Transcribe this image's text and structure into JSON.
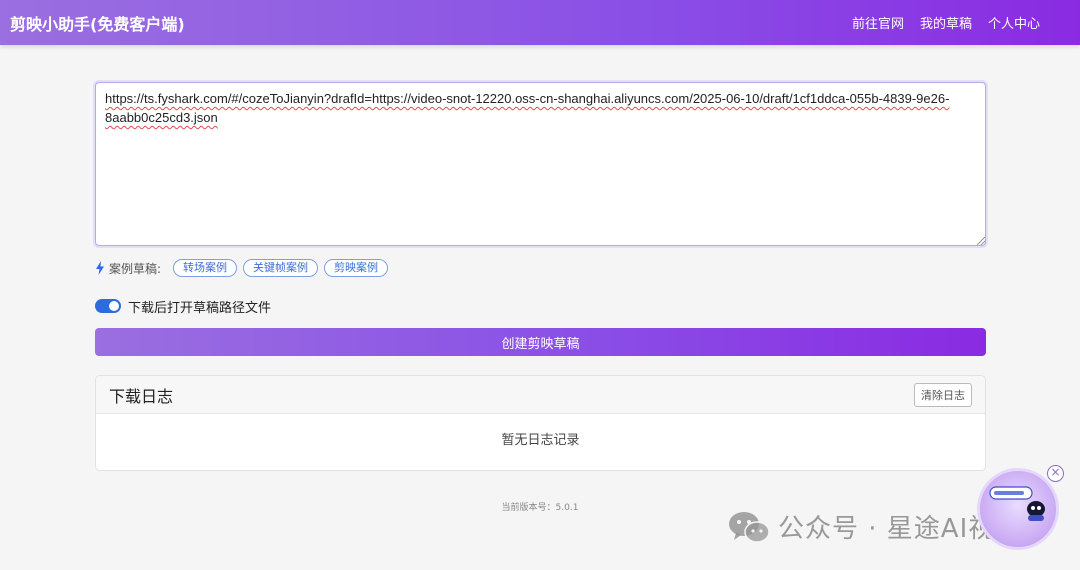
{
  "navbar": {
    "brand": "剪映小助手(免费客户端)",
    "links": [
      "前往官网",
      "我的草稿",
      "个人中心"
    ]
  },
  "draft_url": {
    "value": "https://ts.fyshark.com/#/cozeToJianyin?drafId=https://video-snot-12220.oss-cn-shanghai.aliyuncs.com/2025-06-10/draft/1cf1ddca-055b-4839-9e26-8aabb0c25cd3.json"
  },
  "examples": {
    "label": "案例草稿:",
    "icon": "lightning-bolt-icon",
    "tags": [
      "转场案例",
      "关键帧案例",
      "剪映案例"
    ]
  },
  "toggle": {
    "label": "下载后打开草稿路径文件",
    "checked": true
  },
  "create_button": {
    "label": "创建剪映草稿"
  },
  "log": {
    "title": "下载日志",
    "clear_label": "清除日志",
    "empty_text": "暂无日志记录"
  },
  "version_text": "当前版本号：5.0.1",
  "watermark": {
    "icon": "wechat-icon",
    "text": "公众号 · 星途AI视界"
  },
  "assistant": {
    "icon": "robot-assistant-icon",
    "close_icon": "close-icon",
    "close_glyph": "×"
  },
  "colors": {
    "accent_start": "#9a6fe0",
    "accent_end": "#8a2be2",
    "tag_blue": "#3b6fd4",
    "toggle_blue": "#2d6cdf"
  }
}
